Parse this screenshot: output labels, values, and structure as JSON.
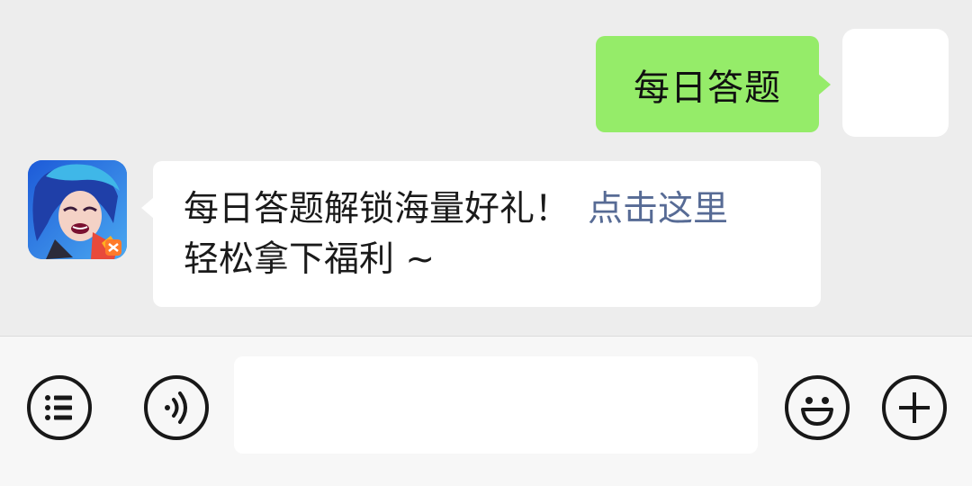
{
  "chat": {
    "sent": {
      "text": "每日答题"
    },
    "received": {
      "line1": "每日答题解锁海量好礼！",
      "link": "点击这里",
      "line2": "轻松拿下福利 ~",
      "link_color": "#576b95"
    }
  },
  "colors": {
    "background": "#ededed",
    "sent_bubble": "#95ec69",
    "received_bubble": "#ffffff",
    "toolbar": "#f7f7f7"
  },
  "toolbar": {
    "input": {
      "value": "",
      "placeholder": ""
    },
    "icons": [
      "menu-list-icon",
      "voice-icon",
      "emoji-icon",
      "plus-icon"
    ]
  }
}
